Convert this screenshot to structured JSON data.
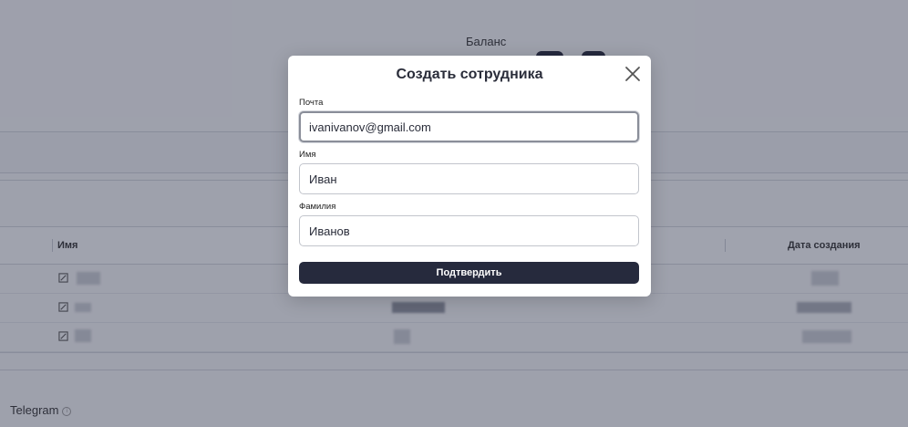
{
  "background": {
    "balance_label": "Баланс",
    "table": {
      "columns": [
        "Имя",
        "Дата создания"
      ],
      "rows": [
        {
          "name": ""
        },
        {
          "name": ""
        },
        {
          "name": ""
        }
      ]
    },
    "telegram_label": "Telegram"
  },
  "modal": {
    "title": "Создать сотрудника",
    "fields": {
      "email": {
        "label": "Почта",
        "value": "ivanivanov@gmail.com"
      },
      "first_name": {
        "label": "Имя",
        "value": "Иван"
      },
      "last_name": {
        "label": "Фамилия",
        "value": "Иванов"
      }
    },
    "submit_label": "Подтвердить"
  },
  "icons": [
    "close-icon",
    "edit-icon",
    "info-icon"
  ],
  "colors": {
    "primary": "#262a3d",
    "overlay": "rgba(40,45,70,0.42)"
  }
}
